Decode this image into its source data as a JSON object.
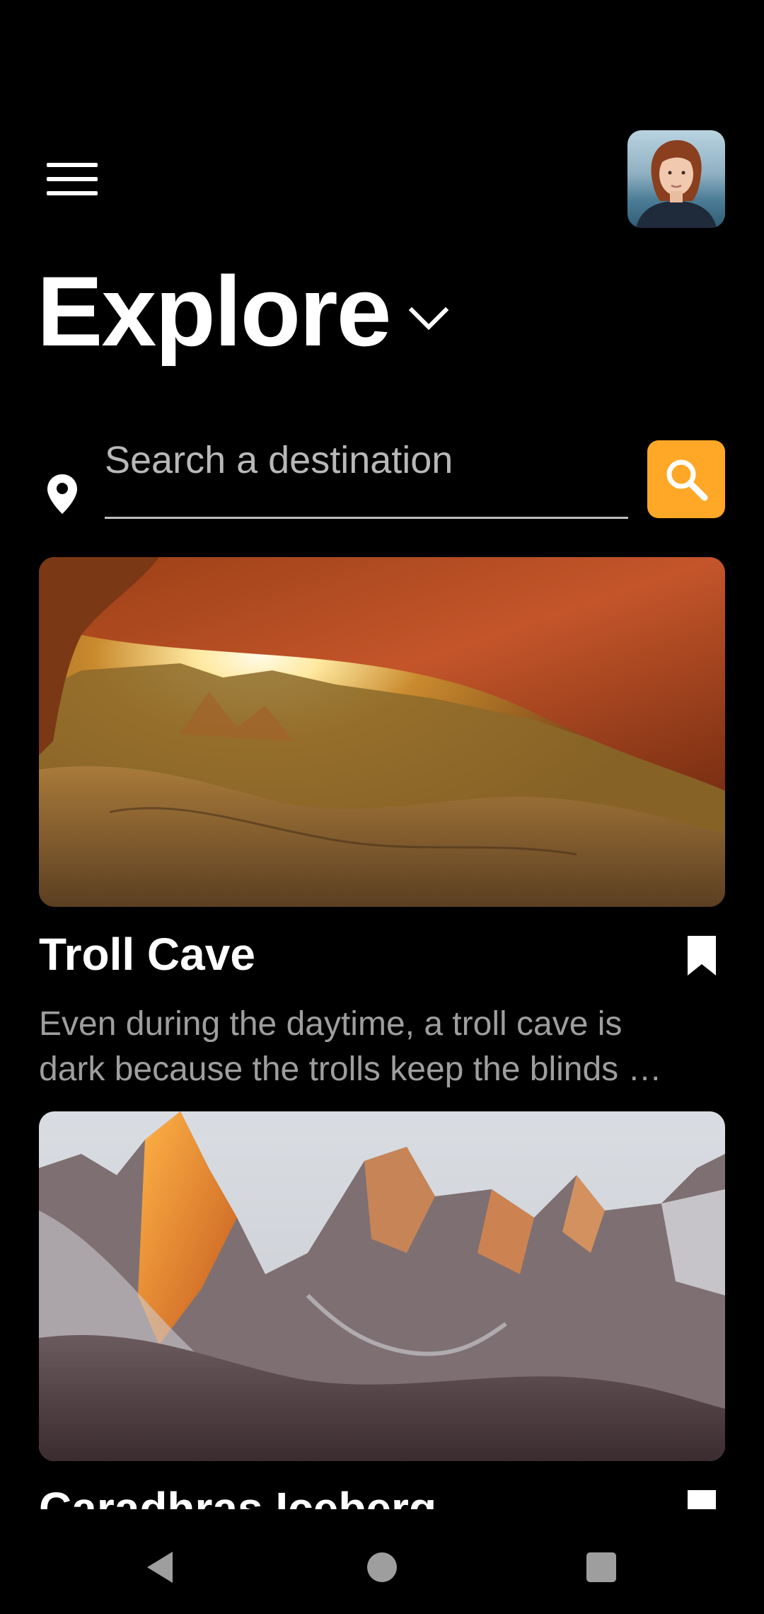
{
  "header": {
    "title": "Explore"
  },
  "search": {
    "placeholder": "Search a destination",
    "value": ""
  },
  "colors": {
    "background": "#000000",
    "accent": "#ffa726",
    "description": "#9e9e9e"
  },
  "icons": {
    "menu": "hamburger-menu-icon",
    "dropdown": "chevron-down-icon",
    "location": "location-pin-icon",
    "search": "search-icon",
    "bookmark": "bookmark-icon",
    "back": "back-triangle-icon",
    "home": "home-circle-icon",
    "recents": "recents-square-icon"
  },
  "places": [
    {
      "title": "Troll Cave",
      "description_line1": "Even during the daytime, a troll cave is",
      "description_line2": "dark because the trolls keep the blinds …"
    },
    {
      "title": "Caradhras Iceberg"
    }
  ]
}
